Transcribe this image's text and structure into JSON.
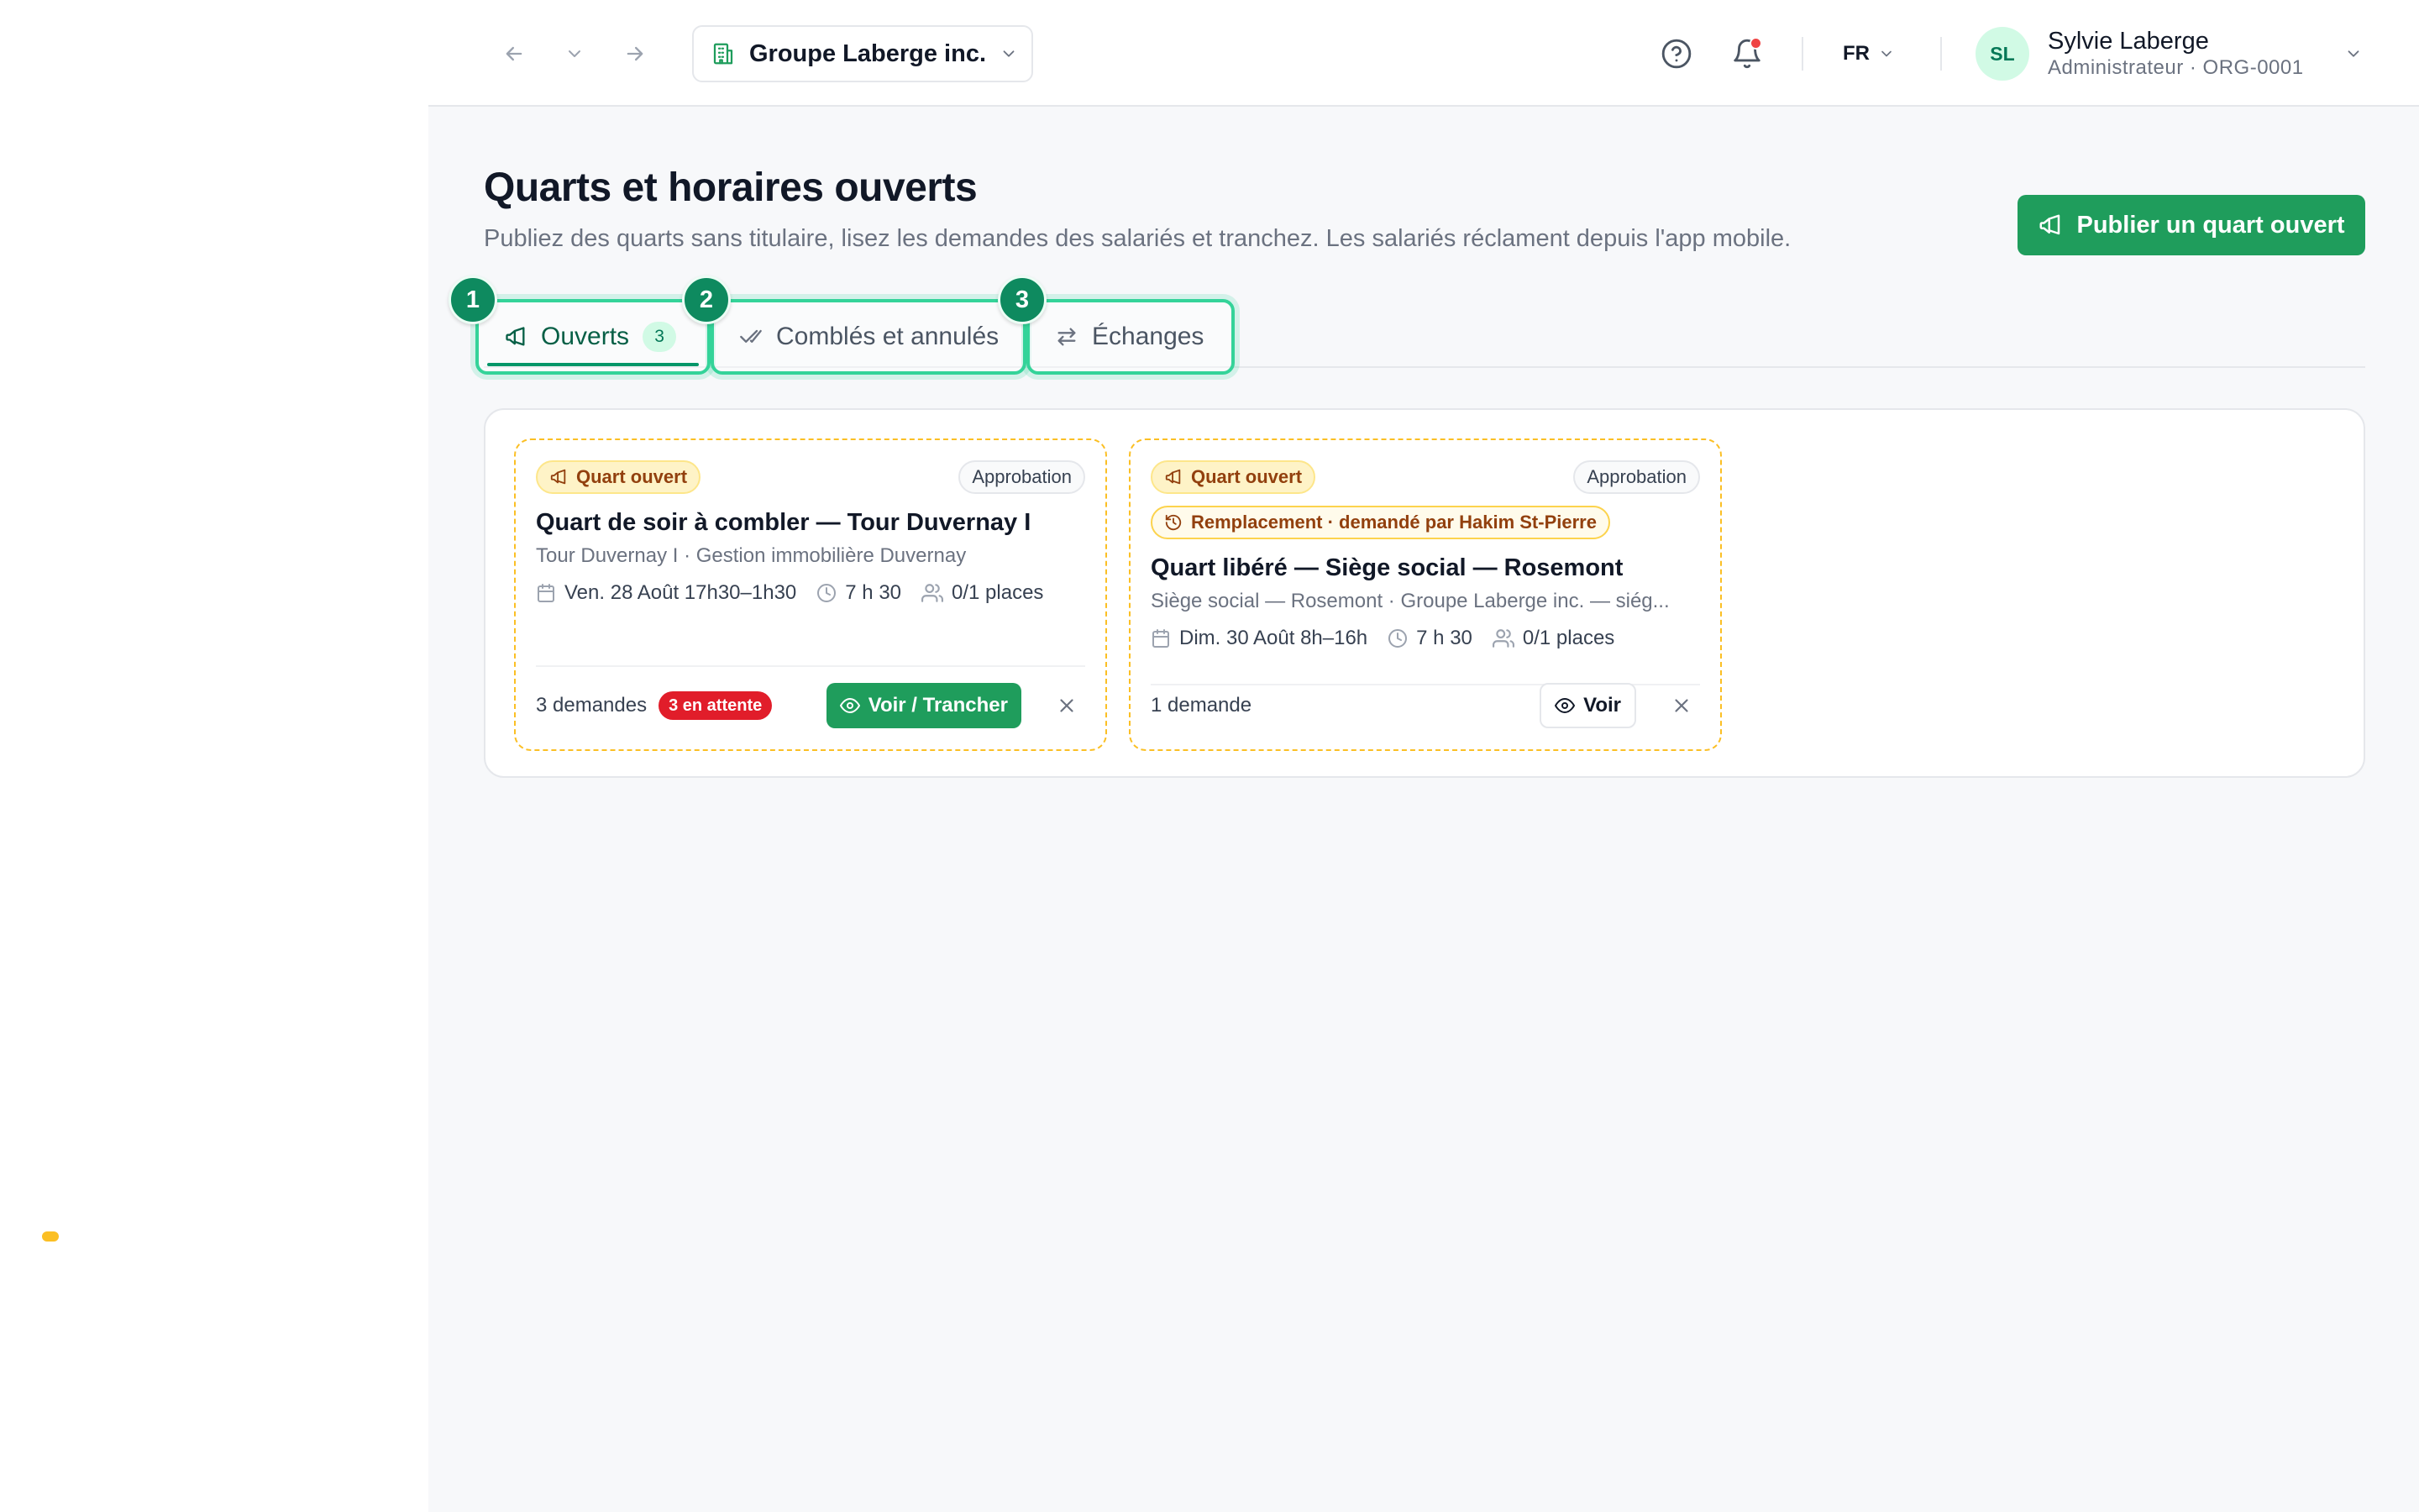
{
  "topbar": {
    "org_name": "Groupe Laberge inc.",
    "language": "FR",
    "user": {
      "initials": "SL",
      "name": "Sylvie Laberge",
      "role": "Administrateur · ORG-0001"
    },
    "icons": [
      "back-arrow-icon",
      "history-chevron-icon",
      "forward-arrow-icon",
      "building-icon",
      "help-icon",
      "bell-icon"
    ],
    "has_unread_notifications": true
  },
  "header": {
    "title": "Quarts et horaires ouverts",
    "subtitle": "Publiez des quarts sans titulaire, lisez les demandes des salariés et tranchez. Les salariés réclament depuis l'app mobile.",
    "publish_button": "Publier un quart ouvert"
  },
  "tabs": [
    {
      "step": "1",
      "label": "Ouverts",
      "count": "3",
      "active": true
    },
    {
      "step": "2",
      "label": "Comblés et annulés",
      "active": false
    },
    {
      "step": "3",
      "label": "Échanges",
      "active": false
    }
  ],
  "cards": [
    {
      "badge": "Quart ouvert",
      "approval": "Approbation",
      "title": "Quart de soir à combler — Tour Duvernay I",
      "subtitle": "Tour Duvernay I · Gestion immobilière Duvernay",
      "date": "Ven. 28 Août 17h30–1h30",
      "duration": "7 h 30",
      "places": "0/1 places",
      "requests": "3 demandes",
      "pending": "3 en attente",
      "action": "Voir / Trancher"
    },
    {
      "badge": "Quart ouvert",
      "approval": "Approbation",
      "replacement": "Remplacement · demandé par Hakim St-Pierre",
      "title": "Quart libéré — Siège social — Rosemont",
      "subtitle": "Siège social — Rosemont · Groupe Laberge inc. — siég...",
      "date": "Dim. 30 Août 8h–16h",
      "duration": "7 h 30",
      "places": "0/1 places",
      "requests": "1 demande",
      "action": "Voir"
    }
  ],
  "colors": {
    "accent": "#1f9d5c",
    "tab_highlight": "#34d399",
    "warning_border": "#fbbf24",
    "danger": "#e11d2a"
  }
}
